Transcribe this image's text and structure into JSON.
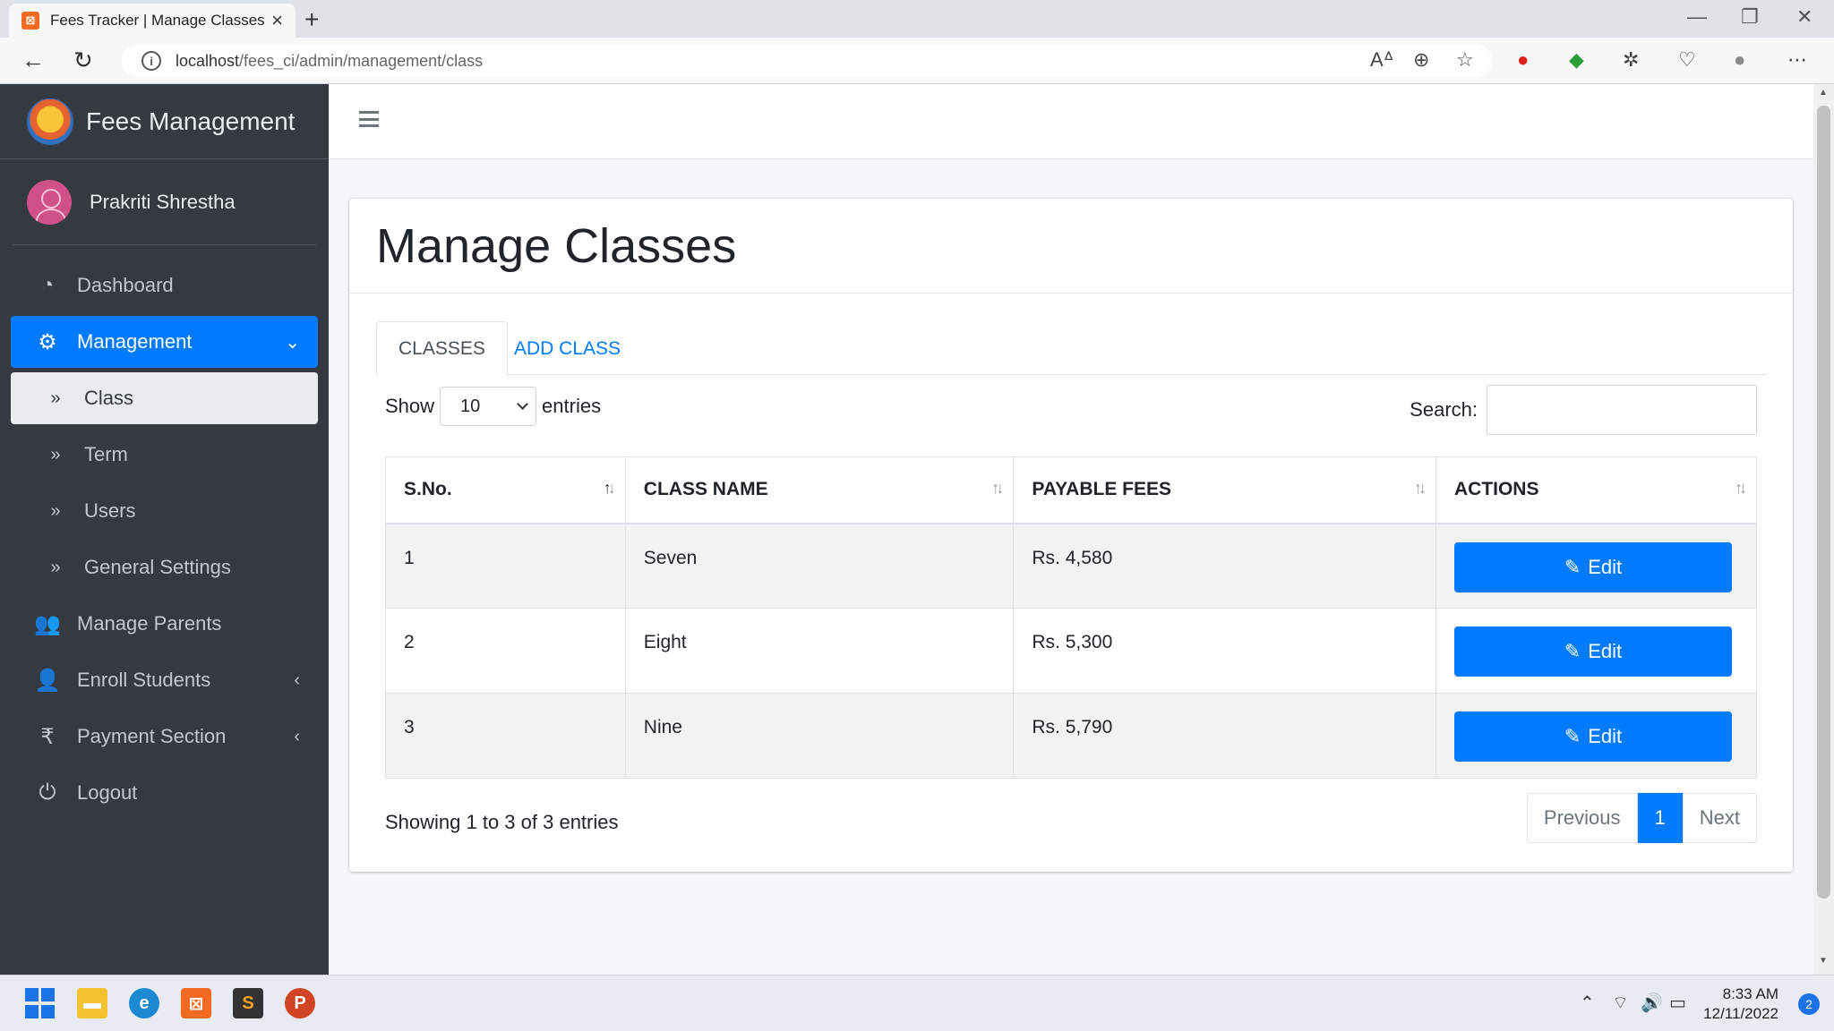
{
  "browser": {
    "tab_title": "Fees Tracker | Manage Classes",
    "url_host": "localhost",
    "url_path": "/fees_ci/admin/management/class"
  },
  "sidebar": {
    "brand": "Fees Management",
    "user_name": "Prakriti Shrestha",
    "items": [
      {
        "label": "Dashboard",
        "icon": "dashboard-icon"
      },
      {
        "label": "Management",
        "icon": "gears-icon"
      },
      {
        "label": "Class",
        "icon": "double-chevron-icon"
      },
      {
        "label": "Term",
        "icon": "double-chevron-icon"
      },
      {
        "label": "Users",
        "icon": "double-chevron-icon"
      },
      {
        "label": "General Settings",
        "icon": "double-chevron-icon"
      },
      {
        "label": "Manage Parents",
        "icon": "users-icon"
      },
      {
        "label": "Enroll Students",
        "icon": "user-plus-icon"
      },
      {
        "label": "Payment Section",
        "icon": "rupee-icon"
      },
      {
        "label": "Logout",
        "icon": "power-icon"
      }
    ]
  },
  "page": {
    "title": "Manage Classes",
    "tabs": [
      "CLASSES",
      "ADD CLASS"
    ],
    "show_label": "Show",
    "entries_value": "10",
    "entries_label": "entries",
    "search_label": "Search:",
    "search_value": ""
  },
  "table": {
    "headers": [
      "S.No.",
      "CLASS NAME",
      "PAYABLE FEES",
      "ACTIONS"
    ],
    "rows": [
      {
        "sno": "1",
        "class_name": "Seven",
        "fees": "Rs. 4,580",
        "action": "Edit"
      },
      {
        "sno": "2",
        "class_name": "Eight",
        "fees": "Rs. 5,300",
        "action": "Edit"
      },
      {
        "sno": "3",
        "class_name": "Nine",
        "fees": "Rs. 5,790",
        "action": "Edit"
      }
    ]
  },
  "footer": {
    "info": "Showing 1 to 3 of 3 entries",
    "prev": "Previous",
    "page": "1",
    "next": "Next"
  },
  "taskbar": {
    "time": "8:33 AM",
    "date": "12/11/2022",
    "notifications": "2"
  },
  "colors": {
    "primary": "#007bff",
    "sidebar_bg": "#343a40"
  }
}
